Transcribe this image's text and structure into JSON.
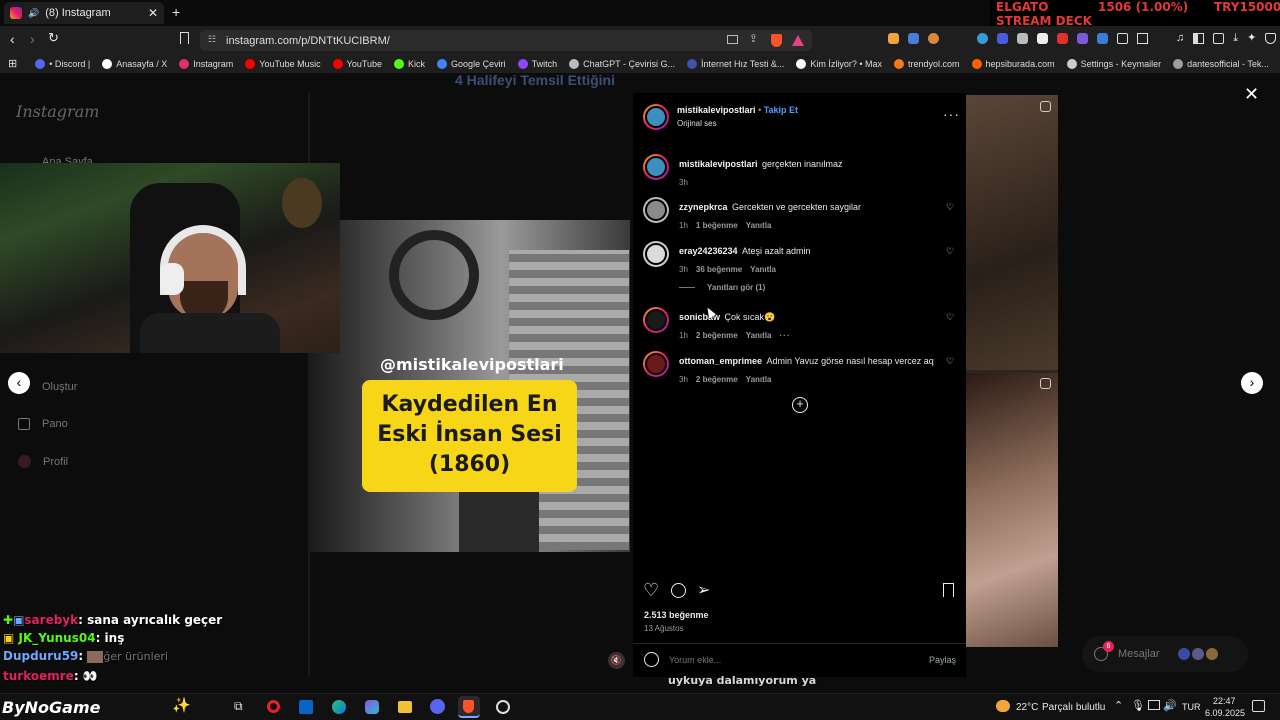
{
  "browser": {
    "tab_title": "(8) Instagram",
    "url": "instagram.com/p/DNTtKUCIBRM/",
    "ticker": {
      "line1_a": "ELGATO",
      "line1_b": "1506 (1.00%)",
      "line1_c": "TRY15000",
      "line2": "STREAM DECK"
    },
    "bookmarks": [
      {
        "label": "• Discord |",
        "color": "#5865f2"
      },
      {
        "label": "Anasayfa / X",
        "color": "#ffffff"
      },
      {
        "label": "Instagram",
        "color": "#e1306c"
      },
      {
        "label": "YouTube Music",
        "color": "#ff0000"
      },
      {
        "label": "YouTube",
        "color": "#ff0000"
      },
      {
        "label": "Kick",
        "color": "#53fc18"
      },
      {
        "label": "Google Çeviri",
        "color": "#4285f4"
      },
      {
        "label": "Twitch",
        "color": "#9146ff"
      },
      {
        "label": "ChatGPT - Çevirisi G...",
        "color": "#bbbbbb"
      },
      {
        "label": "İnternet Hız Testi &...",
        "color": "#3f51b5"
      },
      {
        "label": "Kim İzliyor? • Max",
        "color": "#ffffff"
      },
      {
        "label": "trendyol.com",
        "color": "#f27a1a"
      },
      {
        "label": "hepsiburada.com",
        "color": "#ff6000"
      },
      {
        "label": "Settings - Keymailer",
        "color": "#cccccc"
      },
      {
        "label": "dantesofficial - Tek...",
        "color": "#9e9e9e"
      }
    ]
  },
  "instagram": {
    "logo": "Instagram",
    "sidebar": {
      "home": "Ana Sayfa",
      "create": "Oluştur",
      "dashboard": "Pano",
      "profile": "Profil"
    },
    "banner_text": "4 Halifeyi Temsil Ettiğini",
    "video": {
      "watermark": "@mistikalevipostlari",
      "caption_line1": "Kaydedilen En",
      "caption_line2": "Eski İnsan Sesi",
      "caption_line3": "(1860)"
    },
    "post": {
      "author": "mistikalevipostlari",
      "follow": "Takip Et",
      "audio": "Orijinal ses",
      "caption": {
        "user": "mistikalevipostlari",
        "text": "gerçekten inanılmaz",
        "time": "3h"
      },
      "comments": [
        {
          "user": "zzynepkrca",
          "text": "Gercekten ve gercekten saygilar",
          "time": "1h",
          "likes": "1 beğenme",
          "reply": "Yanıtla"
        },
        {
          "user": "eray24236234",
          "text": "Ateşi azalt admin",
          "time": "3h",
          "likes": "36 beğenme",
          "reply": "Yanıtla",
          "view_replies": "Yanıtları gör (1)"
        },
        {
          "user": "sonicbaw",
          "text": "Çok sıcak😮",
          "time": "1h",
          "likes": "2 beğenme",
          "reply": "Yanıtla"
        },
        {
          "user": "ottoman_emprimee",
          "text": "Admin Yavuz görse nasıl hesap vercez aq",
          "time": "3h",
          "likes": "2 beğenme",
          "reply": "Yanıtla"
        }
      ],
      "likes": "2.513 beğenme",
      "date": "13 Ağustos",
      "comment_placeholder": "Yorum ekle...",
      "post_button": "Paylaş"
    },
    "messages_label": "Mesajlar",
    "message_badge": "6"
  },
  "stream_overlay": {
    "chat": [
      {
        "user": "sarebyk",
        "text": ": sana ayrıcalık geçer",
        "color": "#e0245e"
      },
      {
        "user": "JK_Yunus04",
        "text": ": inş",
        "color": "#53fc18"
      },
      {
        "user": "Dupduru59",
        "text": ":",
        "color": "#6fa8ff"
      },
      {
        "user": "turkoemre",
        "text": ": 👀",
        "color": "#e0245e"
      }
    ],
    "subtitle": "uykuya dalamıyorum ya",
    "behind_text": "ğer ürünleri",
    "brand": "ByNoGame"
  },
  "taskbar": {
    "weather_temp": "22°C",
    "weather_text": "Parçalı bulutlu",
    "lang": "TUR",
    "time": "22:47",
    "date": "6.09.2025"
  }
}
